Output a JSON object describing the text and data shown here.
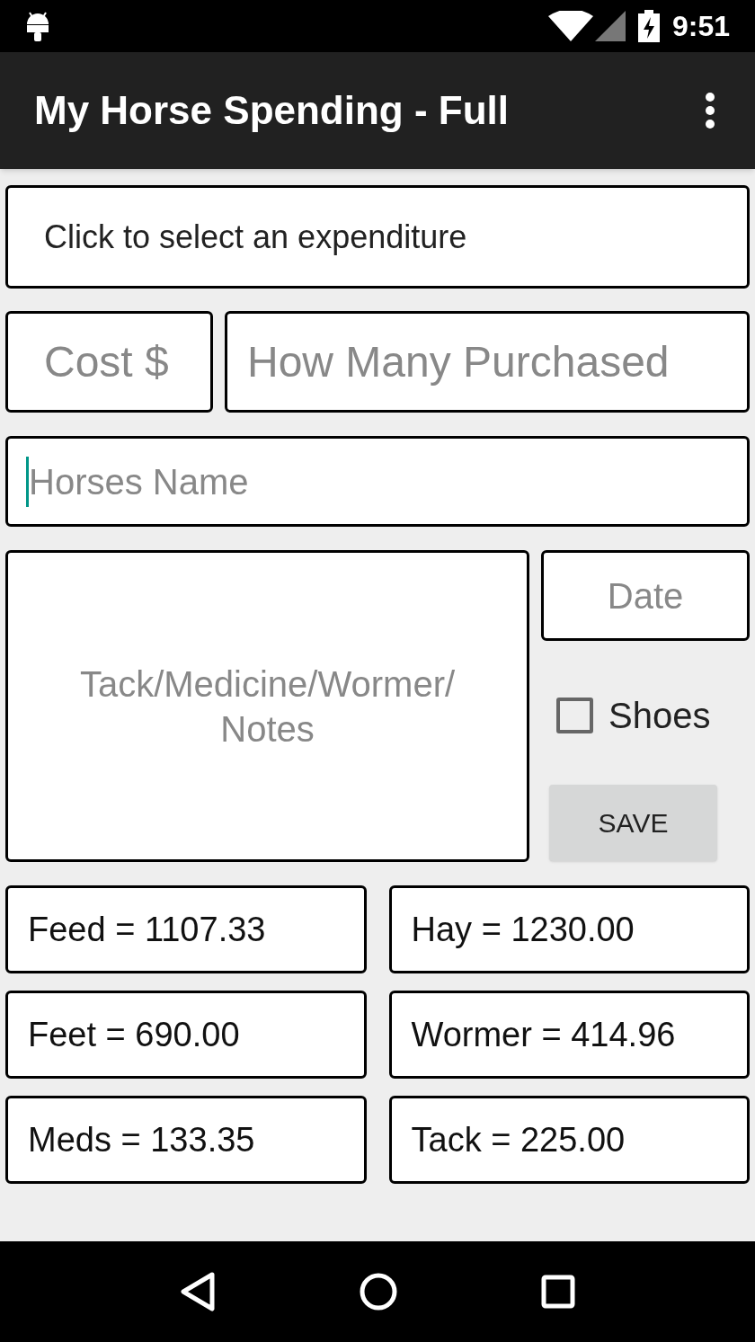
{
  "status_bar": {
    "time": "9:51"
  },
  "app_bar": {
    "title": "My Horse Spending - Full"
  },
  "expenditure_spinner": {
    "text": "Click to select an expenditure"
  },
  "cost_field": {
    "placeholder": "Cost $"
  },
  "quantity_field": {
    "placeholder": "How Many Purchased"
  },
  "horse_name_field": {
    "placeholder": "Horses Name",
    "focused": true
  },
  "notes_field": {
    "placeholder": "Tack/Medicine/Wormer/\nNotes"
  },
  "date_field": {
    "placeholder": "Date"
  },
  "shoes_checkbox": {
    "label": "Shoes",
    "checked": false
  },
  "save_button": {
    "label": "SAVE"
  },
  "totals": [
    {
      "text": "Feed = 1107.33"
    },
    {
      "text": "Hay = 1230.00"
    },
    {
      "text": "Feet = 690.00"
    },
    {
      "text": "Wormer = 414.96"
    },
    {
      "text": "Meds = 133.35"
    },
    {
      "text": "Tack = 225.00"
    }
  ]
}
